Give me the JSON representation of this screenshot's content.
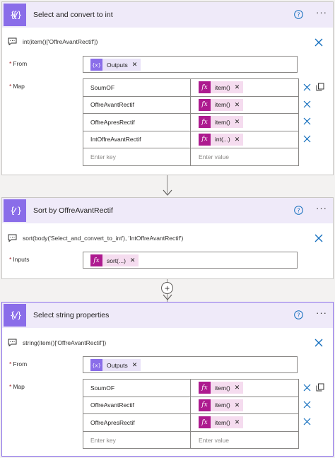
{
  "cards": [
    {
      "title": "Select and convert to int",
      "comment": "int(item()['OffreAvantRectif'])",
      "from_label": "From",
      "from_token": "Outputs",
      "map_label": "Map",
      "rows": [
        {
          "key": "SoumOF",
          "value": "item()"
        },
        {
          "key": "OffreAvantRectif",
          "value": "item()"
        },
        {
          "key": "OffreApresRectif",
          "value": "item()"
        },
        {
          "key": "IntOffreAvantRectif",
          "value": "int(...)"
        }
      ],
      "key_placeholder": "Enter key",
      "value_placeholder": "Enter value"
    },
    {
      "title": "Sort by OffreAvantRectif",
      "comment": "sort(body('Select_and_convert_to_int'), 'IntOffreAvantRectif')",
      "inputs_label": "Inputs",
      "inputs_token": "sort(...)"
    },
    {
      "title": "Select string properties",
      "comment": "string(item()['OffreAvantRectif'])",
      "from_label": "From",
      "from_token": "Outputs",
      "map_label": "Map",
      "rows": [
        {
          "key": "SoumOF",
          "value": "item()"
        },
        {
          "key": "OffreAvantRectif",
          "value": "item()"
        },
        {
          "key": "OffreApresRectif",
          "value": "item()"
        }
      ],
      "key_placeholder": "Enter key",
      "value_placeholder": "Enter value"
    }
  ],
  "icons": {
    "card_header": "data-operation-icon",
    "help": "help-icon",
    "more": "more-options-icon",
    "comment": "comment-icon",
    "close": "close-icon",
    "copy": "copy-icon",
    "fx": "fx-icon",
    "variable": "variable-icon"
  },
  "colors": {
    "header_bg": "#efeaf9",
    "accent": "#8a6de9",
    "fx_token": "#ad1a8f",
    "fx_token_bg": "#f5dcef",
    "close_blue": "#0f6cbd",
    "required": "#a4262c"
  }
}
